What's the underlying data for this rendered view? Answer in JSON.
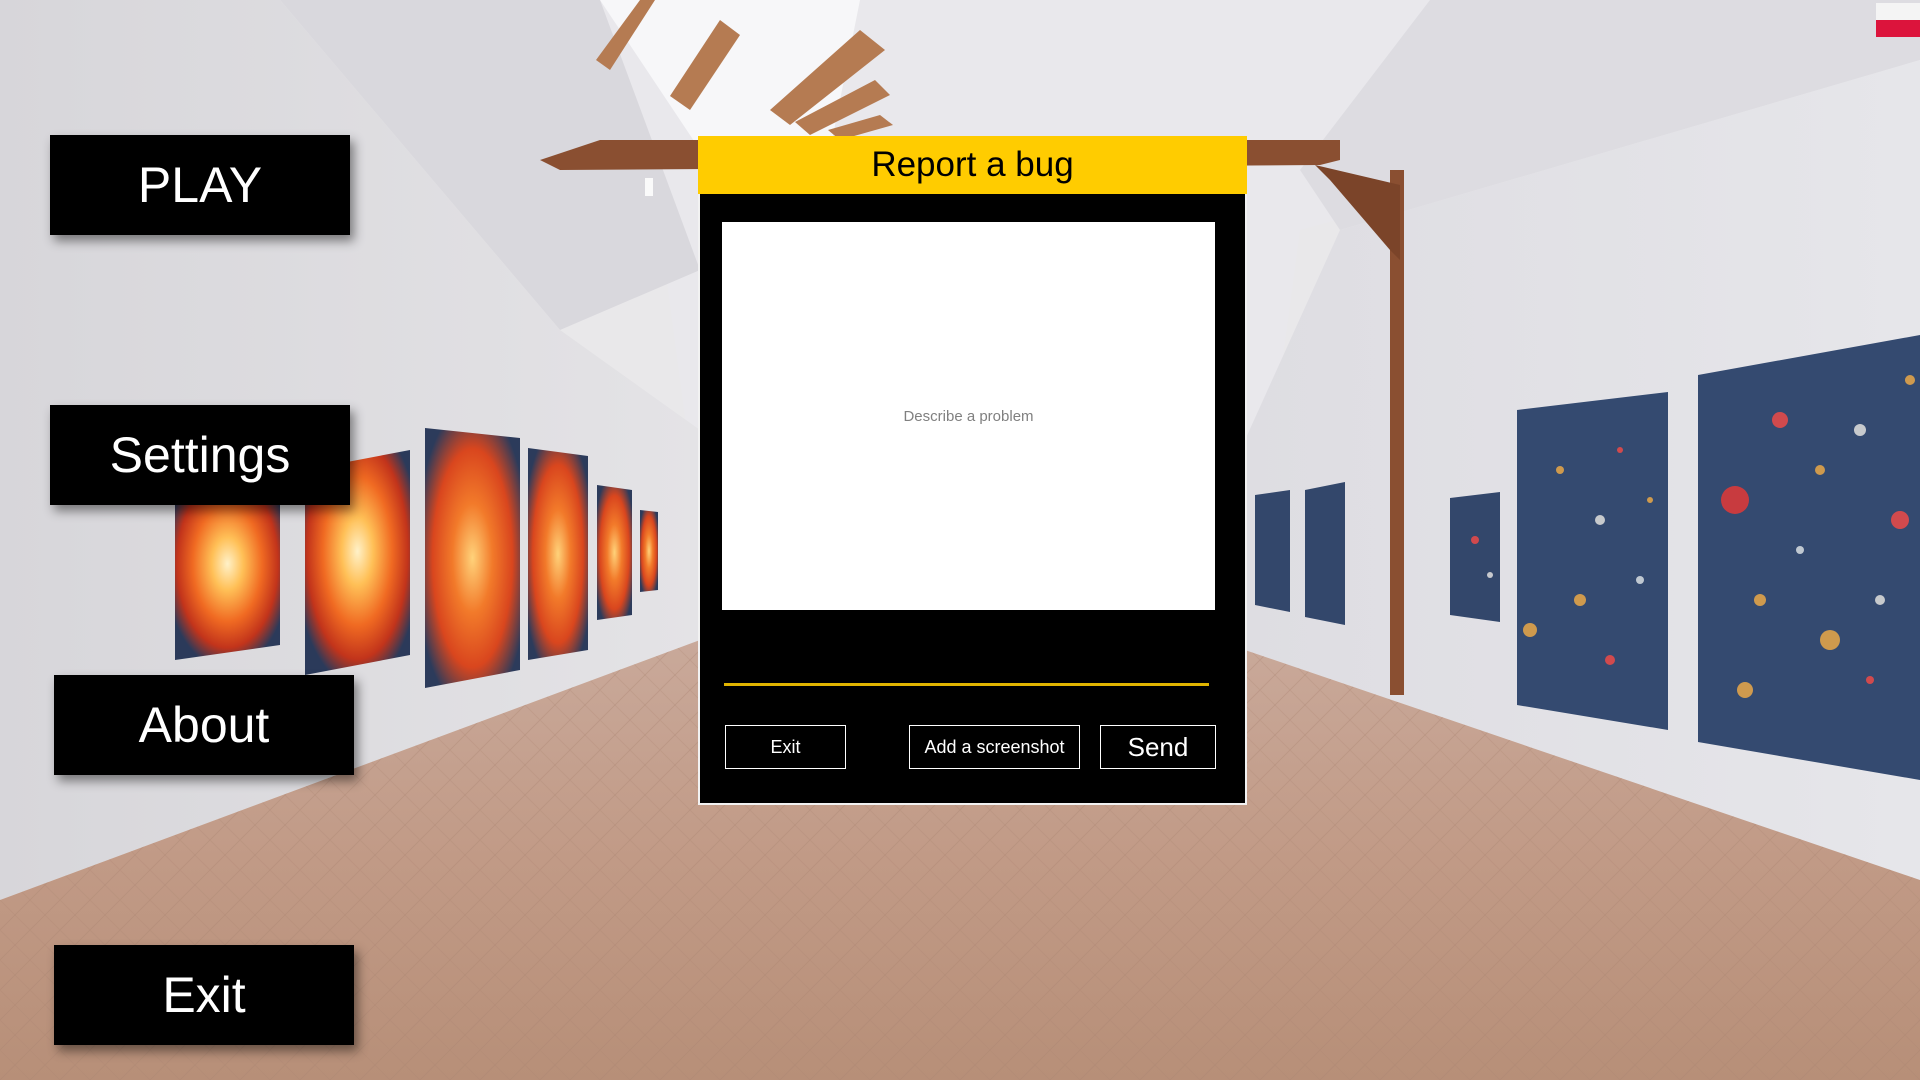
{
  "menu": {
    "play": "PLAY",
    "settings": "Settings",
    "about": "About",
    "exit": "Exit"
  },
  "language": {
    "icon": "flag-poland-icon",
    "colors": [
      "#f4f4f4",
      "#dc143c"
    ]
  },
  "bug_report": {
    "title": "Report a bug",
    "placeholder": "Describe a problem",
    "exit_label": "Exit",
    "screenshot_label": "Add a screenshot",
    "send_label": "Send"
  },
  "colors": {
    "accent": "#ffcc00",
    "button_bg": "#000000",
    "button_text": "#ffffff"
  }
}
